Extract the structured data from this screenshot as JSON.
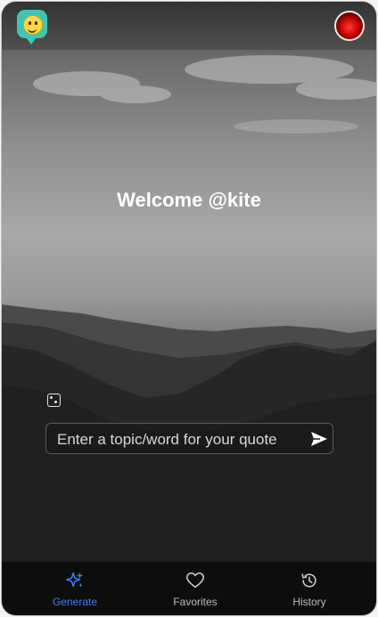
{
  "header": {
    "logo_icon": "smiley-chat-logo-icon",
    "avatar_icon": "user-avatar"
  },
  "welcome": {
    "text": "Welcome @kite"
  },
  "prompt": {
    "dice_icon": "dice-icon",
    "input_placeholder": "Enter a topic/word for your quote",
    "input_value": "",
    "send_icon": "send-icon"
  },
  "nav": {
    "items": [
      {
        "label": "Generate",
        "icon": "sparkles-icon",
        "active": true
      },
      {
        "label": "Favorites",
        "icon": "heart-icon",
        "active": false
      },
      {
        "label": "History",
        "icon": "history-icon",
        "active": false
      }
    ]
  },
  "colors": {
    "accent": "#3b82f6",
    "logo_bg": "#3ec6b5",
    "nav_bg": "#0d0d0d"
  }
}
